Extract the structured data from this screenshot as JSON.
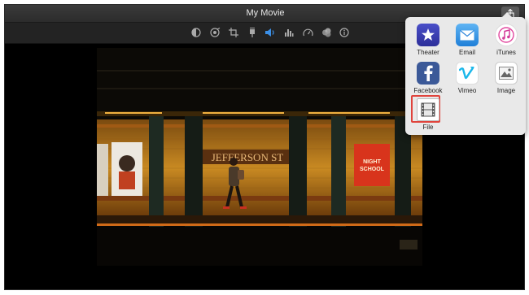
{
  "window": {
    "title": "My Movie"
  },
  "toolbar": {
    "tools": [
      "color-balance-icon",
      "color-correction-icon",
      "crop-icon",
      "stabilization-icon",
      "volume-icon",
      "noise-reduction-icon",
      "speed-icon",
      "clip-filter-icon",
      "info-icon"
    ]
  },
  "share_menu": {
    "items": [
      {
        "label": "Theater",
        "icon": "theater-icon"
      },
      {
        "label": "Email",
        "icon": "email-icon"
      },
      {
        "label": "iTunes",
        "icon": "itunes-icon"
      },
      {
        "label": "Facebook",
        "icon": "facebook-icon"
      },
      {
        "label": "Vimeo",
        "icon": "vimeo-icon"
      },
      {
        "label": "Image",
        "icon": "image-icon"
      },
      {
        "label": "File",
        "icon": "file-icon",
        "selected": true
      }
    ]
  },
  "viewer": {
    "scene": {
      "sign_text": "JEFFERSON ST",
      "poster_text_line1": "NIGHT",
      "poster_text_line2": "SCHOOL"
    }
  },
  "colors": {
    "accent_red": "#e0443c",
    "window_bg": "#000000",
    "popover_bg": "#e9e9e9"
  }
}
